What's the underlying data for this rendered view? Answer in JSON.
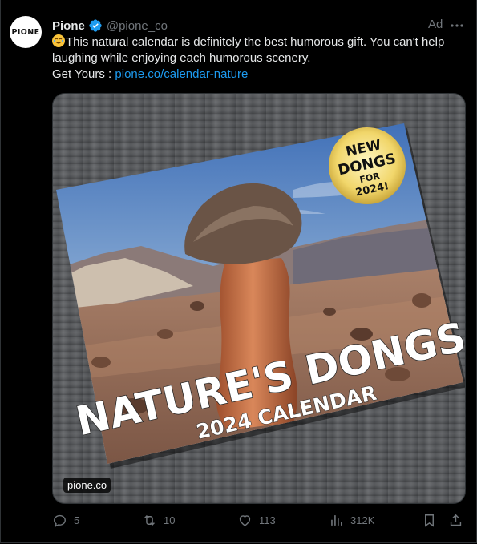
{
  "tweet": {
    "avatar_text": "PIONE",
    "name": "Pione",
    "handle": "@pione_co",
    "ad_label": "Ad",
    "text": "This natural calendar is definitely the best humorous gift. You can't help laughing while enjoying each humorous scenery.",
    "get_yours": "Get Yours :",
    "link": "pione.co/calendar-nature"
  },
  "media": {
    "badge_line1": "NEW",
    "badge_line2": "DONGS",
    "badge_line3": "FOR",
    "badge_line4": "2024!",
    "title": "NATURE'S DONGS",
    "subtitle": "2024 CALENDAR",
    "source_label": "pione.co"
  },
  "actions": {
    "replies": "5",
    "reposts": "10",
    "likes": "113",
    "views": "312K"
  },
  "colors": {
    "accent": "#1d9bf0",
    "muted": "#71767b",
    "text": "#e7e9ea",
    "background": "#000000"
  }
}
